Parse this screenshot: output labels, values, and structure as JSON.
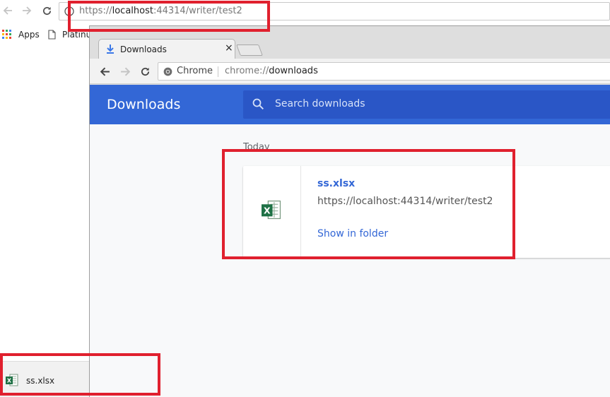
{
  "back_window": {
    "omnibox": {
      "scheme": "https://",
      "host": "localhost",
      "rest": ":44314/writer/test2"
    },
    "bookmarks": [
      {
        "label": "Apps",
        "icon": "apps-grid-icon"
      },
      {
        "label": "Platinu",
        "icon": "page-icon"
      }
    ],
    "download_shelf": {
      "file_name": "ss.xlsx",
      "icon": "excel-file-icon"
    }
  },
  "front_window": {
    "tab": {
      "label": "Downloads",
      "icon": "download-icon",
      "close": "×"
    },
    "omnibox": {
      "chip": "Chrome",
      "scheme": "chrome://",
      "host": "downloads"
    },
    "page": {
      "header_title": "Downloads",
      "search_placeholder": "Search downloads",
      "section_label": "Today",
      "item": {
        "file_name": "ss.xlsx",
        "url": "https://localhost:44314/writer/test2",
        "action": "Show in folder",
        "icon": "excel-file-icon"
      }
    }
  },
  "colors": {
    "header_blue": "#3367d6",
    "search_blue": "#2a56c6",
    "link_blue": "#3367d6",
    "annotation_red": "#e0202e",
    "excel_green": "#1e7145"
  }
}
